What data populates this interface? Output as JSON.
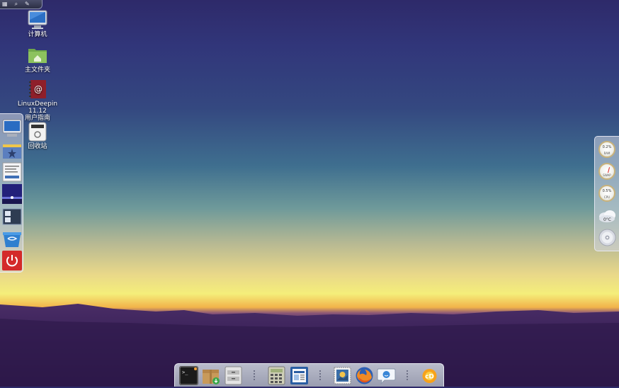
{
  "top_panel": {
    "items": [
      {
        "icon": "grid-icon",
        "glyph": "▦"
      },
      {
        "icon": "search-icon",
        "glyph": "⌕"
      },
      {
        "icon": "edit-icon",
        "glyph": "✎"
      }
    ]
  },
  "desktop": {
    "icons": [
      {
        "name": "computer",
        "label": "计算机"
      },
      {
        "name": "home-folder",
        "label": "主文件夹"
      },
      {
        "name": "user-guide",
        "label": "LinuxDeepin 11.12\n用户指南"
      },
      {
        "name": "trash",
        "label": "回收站"
      }
    ]
  },
  "left_dock": {
    "items": [
      "computer-icon",
      "file-manager-icon",
      "text-editor-icon",
      "desktop-wallpaper-icon",
      "window-switcher-icon",
      "trash-bin-icon",
      "power-icon"
    ]
  },
  "right_panel": {
    "gauges": [
      {
        "name": "ram-gauge",
        "value": "0.2%",
        "label": "RAM",
        "level": 0.02
      },
      {
        "name": "swap-gauge",
        "value": "",
        "label": "SWAP",
        "level": 0.5
      },
      {
        "name": "cpu-gauge",
        "value": "0.5%",
        "label": "CPU",
        "level": 0.05
      }
    ],
    "weather_label": "0°C"
  },
  "bottom_dock": {
    "items": [
      {
        "name": "terminal",
        "icon": "terminal-icon"
      },
      {
        "name": "software-center",
        "icon": "package-icon"
      },
      {
        "name": "file-cabinet",
        "icon": "cabinet-icon"
      },
      {
        "name": "calculator",
        "icon": "calculator-icon"
      },
      {
        "name": "document-viewer",
        "icon": "document-icon"
      },
      {
        "name": "mail-client",
        "icon": "mail-stamp-icon"
      },
      {
        "name": "firefox",
        "icon": "firefox-icon"
      },
      {
        "name": "chat",
        "icon": "chat-bubble-icon"
      },
      {
        "name": "deepin-cd",
        "icon": "cd-logo-icon"
      }
    ]
  },
  "colors": {
    "sky_top": "#2e2a6a",
    "horizon_yellow": "#f4ee7a",
    "ground": "#2d1845",
    "dock_bg": "#b9bccb",
    "power_red": "#d42a2a"
  }
}
